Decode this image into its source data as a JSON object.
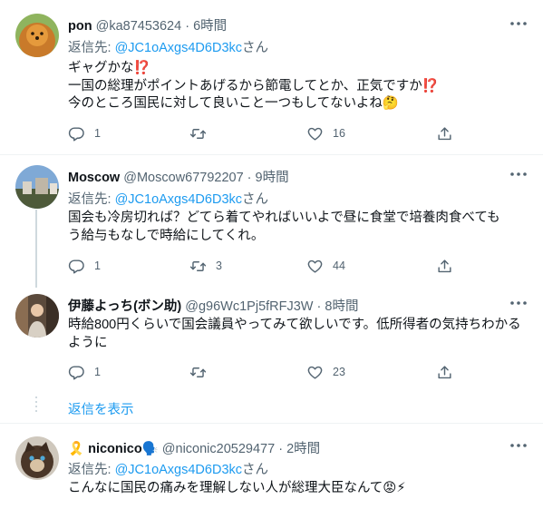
{
  "tweets": [
    {
      "name": "pon",
      "handle": "@ka87453624",
      "sep": " · ",
      "time": "6時間",
      "reply_prefix": "返信先: ",
      "reply_to": "@JC1oAxgs4D6D3kc",
      "reply_suffix": "さん",
      "lines": [
        "ギャグかな⁉️",
        "一国の総理がポイントあげるから節電してとか、正気ですか⁉️",
        "今のところ国民に対して良いこと一つもしてないよね🤔"
      ],
      "replies": "1",
      "retweets": "",
      "likes": "16"
    },
    {
      "name": "Moscow",
      "handle": "@Moscow67792207",
      "sep": " · ",
      "time": "9時間",
      "reply_prefix": "返信先: ",
      "reply_to": "@JC1oAxgs4D6D3kc",
      "reply_suffix": "さん",
      "lines": [
        "国会も冷房切れば？どてら着てやればいいよで昼に食堂で培養肉食べても",
        "う給与もなしで時給にしてくれ。"
      ],
      "replies": "1",
      "retweets": "3",
      "likes": "44"
    },
    {
      "name": "伊藤よっち(ボン助)",
      "handle": "@g96Wc1Pj5fRFJ3W",
      "sep": " · ",
      "time": "8時間",
      "lines": [
        "時給800円くらいで国会議員やってみて欲しいです。低所得者の気持ちわかる",
        "ように"
      ],
      "replies": "1",
      "retweets": "",
      "likes": "23"
    },
    {
      "name": "🎗️ niconico🗣️",
      "handle": "@niconic20529477",
      "sep": " · ",
      "time": "2時間",
      "reply_prefix": "返信先: ",
      "reply_to": "@JC1oAxgs4D6D3kc",
      "reply_suffix": "さん",
      "lines": [
        "こんなに国民の痛みを理解しない人が総理大臣なんて😡⚡"
      ]
    }
  ],
  "show_replies": "返信を表示",
  "icons": {
    "reply": "speech-bubble-icon",
    "retweet": "retweet-arrows-icon",
    "like": "heart-icon",
    "share": "share-upload-icon",
    "more": "more-dots-icon"
  },
  "colors": {
    "accent": "#1d9bf0",
    "secondary_text": "#536471",
    "primary_text": "#0f1419"
  }
}
